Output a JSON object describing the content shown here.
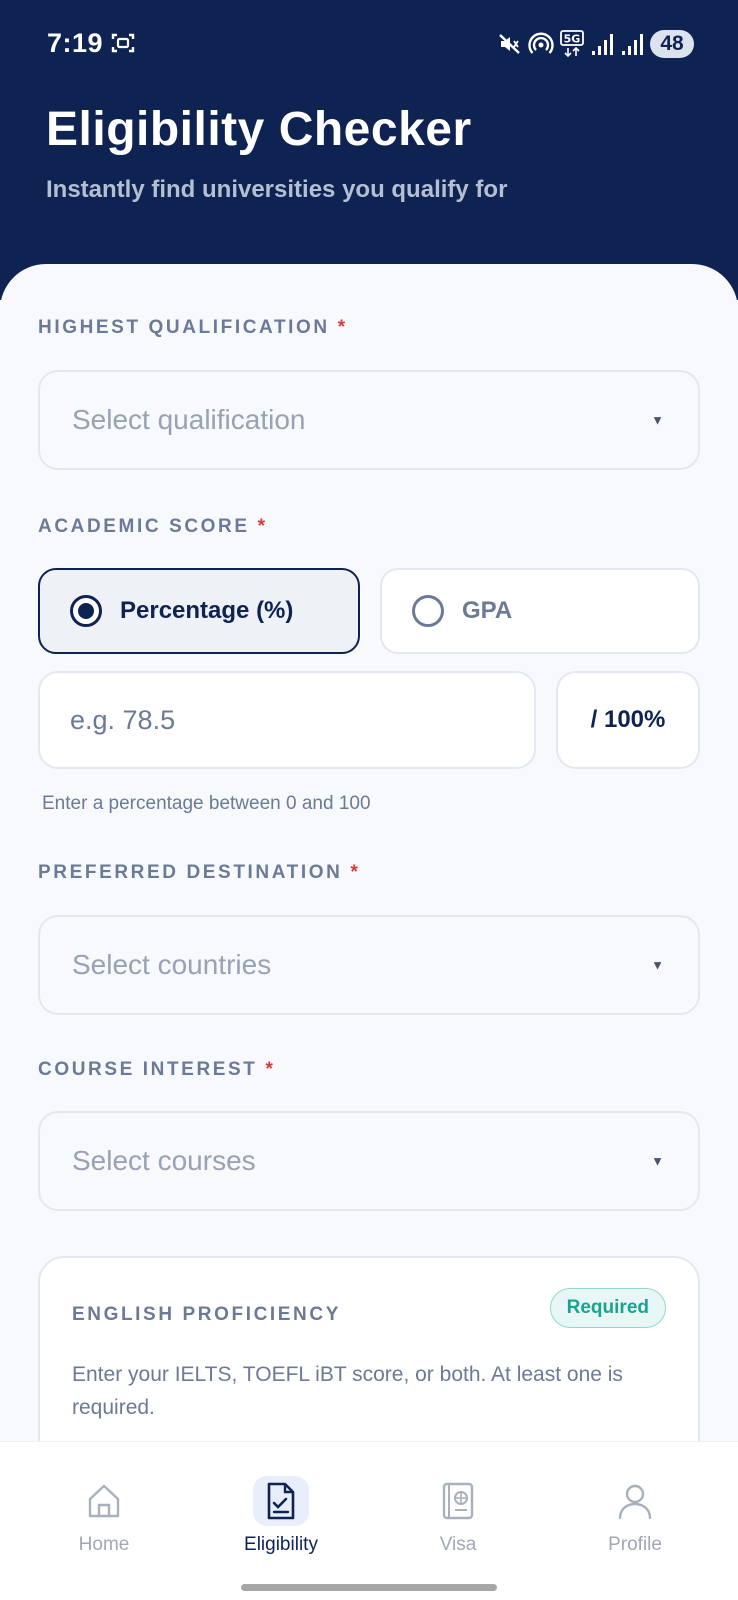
{
  "status_bar": {
    "time": "7:19",
    "network": "5G",
    "battery": "48",
    "icons": [
      "screenshot-icon",
      "mute-icon",
      "hotspot-icon",
      "network-5g-icon",
      "signal-icon",
      "signal-icon",
      "battery-icon"
    ]
  },
  "header": {
    "title": "Eligibility Checker",
    "subtitle": "Instantly find universities you qualify for",
    "background_color": "#0f2353"
  },
  "qualification": {
    "label": "HIGHEST QUALIFICATION",
    "required_mark": "*",
    "placeholder": "Select qualification"
  },
  "academic_score": {
    "label": "ACADEMIC SCORE",
    "required_mark": "*",
    "options": [
      {
        "label": "Percentage (%)",
        "selected": true
      },
      {
        "label": "GPA",
        "selected": false
      }
    ],
    "input_placeholder": "e.g. 78.5",
    "input_value": "",
    "unit": "/ 100%",
    "helper": "Enter a percentage between 0 and 100"
  },
  "destination": {
    "label": "PREFERRED DESTINATION",
    "required_mark": "*",
    "placeholder": "Select countries"
  },
  "course": {
    "label": "COURSE INTEREST",
    "required_mark": "*",
    "placeholder": "Select courses"
  },
  "english": {
    "title": "ENGLISH PROFICIENCY",
    "badge": "Required",
    "description": "Enter your IELTS, TOEFL iBT score, or both. At least one is required."
  },
  "bottom_nav": {
    "items": [
      {
        "label": "Home",
        "icon": "home-icon",
        "active": false
      },
      {
        "label": "Eligibility",
        "icon": "checklist-icon",
        "active": true
      },
      {
        "label": "Visa",
        "icon": "passport-icon",
        "active": false
      },
      {
        "label": "Profile",
        "icon": "person-icon",
        "active": false
      }
    ]
  },
  "colors": {
    "primary": "#0f2353",
    "required": "#d33a3a",
    "badge_teal": "#1aa393",
    "muted_text": "#6b7a96"
  }
}
